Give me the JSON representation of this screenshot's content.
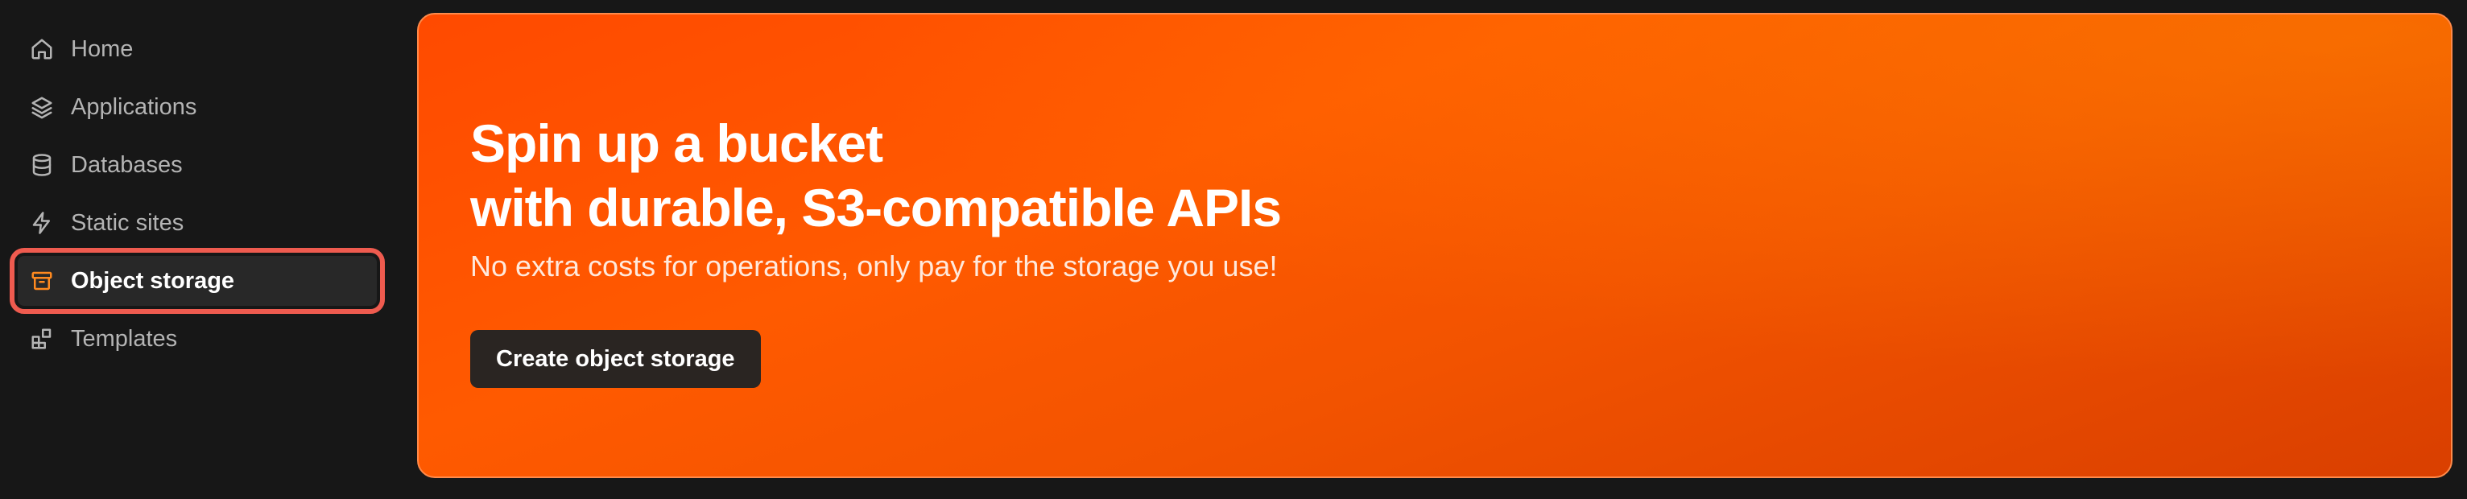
{
  "sidebar": {
    "items": [
      {
        "label": "Home",
        "icon": "home-icon"
      },
      {
        "label": "Applications",
        "icon": "layers-icon"
      },
      {
        "label": "Databases",
        "icon": "database-icon"
      },
      {
        "label": "Static sites",
        "icon": "bolt-icon"
      },
      {
        "label": "Object storage",
        "icon": "archive-box-icon",
        "active": true
      },
      {
        "label": "Templates",
        "icon": "blocks-icon"
      }
    ],
    "active_color": "#ef5b4f",
    "active_icon_color": "#ff8a1f"
  },
  "banner": {
    "title_line1": "Spin up a bucket",
    "title_line2": "with durable, S3-compatible APIs",
    "subtitle": "No extra costs for operations, only pay for the storage you use!",
    "cta_label": "Create object storage",
    "accent_color": "#ff5a00"
  }
}
